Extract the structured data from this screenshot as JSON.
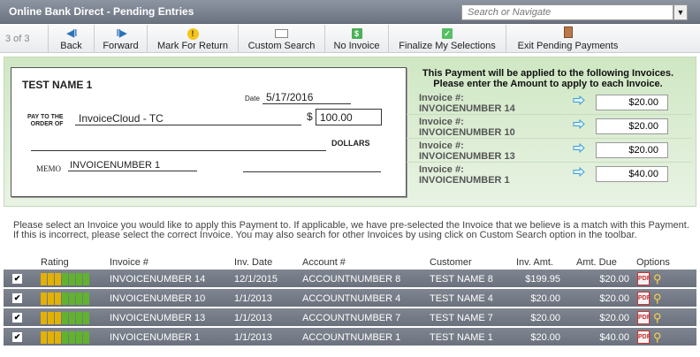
{
  "app": {
    "title": "Online Bank Direct - Pending Entries"
  },
  "search": {
    "placeholder": "Search or Navigate",
    "dropdown_glyph": "▼"
  },
  "toolbar": {
    "pager": "3 of 3",
    "buttons": [
      {
        "label": "Back",
        "icon": "back-arrow-icon"
      },
      {
        "label": "Forward",
        "icon": "forward-arrow-icon"
      },
      {
        "label": "Mark For Return",
        "icon": "warning-icon"
      },
      {
        "label": "Custom Search",
        "icon": "search-window-icon"
      },
      {
        "label": "No Invoice",
        "icon": "dollar-icon"
      },
      {
        "label": "Finalize My Selections",
        "icon": "checkmark-icon"
      },
      {
        "label": "Exit Pending Payments",
        "icon": "door-exit-icon"
      }
    ]
  },
  "check": {
    "name": "TEST NAME 1",
    "date_label": "Date",
    "date": "5/17/2016",
    "pay_to_label": "PAY TO THE ORDER OF",
    "payee": "InvoiceCloud - TC",
    "dollar_sign": "$",
    "amount": "100.00",
    "dollars_label": "DOLLARS",
    "memo_label": "MEMO",
    "memo": "INVOICENUMBER 1"
  },
  "apply": {
    "heading": "This Payment will be applied to the following Invoices. Please enter the Amount to apply to each Invoice.",
    "rows": [
      {
        "label": "Invoice #:",
        "invoice": "INVOICENUMBER 14",
        "amount": "$20.00"
      },
      {
        "label": "Invoice #:",
        "invoice": "INVOICENUMBER 10",
        "amount": "$20.00"
      },
      {
        "label": "Invoice #:",
        "invoice": "INVOICENUMBER 13",
        "amount": "$20.00"
      },
      {
        "label": "Invoice #:",
        "invoice": "INVOICENUMBER 1",
        "amount": "$40.00"
      }
    ]
  },
  "instructions": "Please select an Invoice you would like to apply this Payment to. If applicable, we have pre-selected the Invoice that we believe is a match with this Payment. If this is incorrect, please select the correct Invoice. You may also search for other Invoices by using click on Custom Search option in the toolbar.",
  "grid": {
    "headers": {
      "rating": "Rating",
      "invoice": "Invoice #",
      "date": "Inv. Date",
      "account": "Account #",
      "customer": "Customer",
      "inv_amt": "Inv. Amt.",
      "amt_due": "Amt. Due",
      "options": "Options"
    },
    "rating_colors": [
      "#e2b106",
      "#e2b106",
      "#e2b106",
      "#61b32e",
      "#61b32e",
      "#61b32e",
      "#61b32e"
    ],
    "rows": [
      {
        "checked": "✔",
        "invoice": "INVOICENUMBER 14",
        "date": "12/1/2015",
        "account": "ACCOUNTNUMBER 8",
        "customer": "TEST NAME 8",
        "inv_amt": "$199.95",
        "amt_due": "$20.00"
      },
      {
        "checked": "✔",
        "invoice": "INVOICENUMBER 10",
        "date": "1/1/2013",
        "account": "ACCOUNTNUMBER 4",
        "customer": "TEST NAME 4",
        "inv_amt": "$20.00",
        "amt_due": "$20.00"
      },
      {
        "checked": "✔",
        "invoice": "INVOICENUMBER 13",
        "date": "1/1/2013",
        "account": "ACCOUNTNUMBER 7",
        "customer": "TEST NAME 7",
        "inv_amt": "$20.00",
        "amt_due": "$20.00"
      },
      {
        "checked": "✔",
        "invoice": "INVOICENUMBER 1",
        "date": "1/1/2013",
        "account": "ACCOUNTNUMBER 1",
        "customer": "TEST NAME 1",
        "inv_amt": "$20.00",
        "amt_due": "$40.00"
      }
    ]
  }
}
